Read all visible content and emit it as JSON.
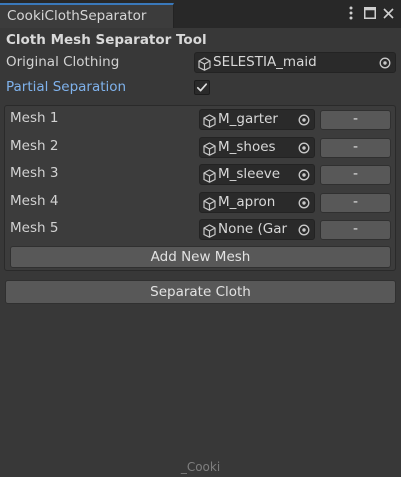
{
  "tab": {
    "title": "CookiClothSeparator"
  },
  "tool": {
    "title": "Cloth Mesh Separator Tool"
  },
  "original_clothing": {
    "label": "Original Clothing",
    "value": "SELESTIA_maid"
  },
  "partial_separation": {
    "label": "Partial Separation",
    "checked": true
  },
  "meshes": [
    {
      "label": "Mesh 1",
      "value": "M_garter",
      "button": "-"
    },
    {
      "label": "Mesh 2",
      "value": "M_shoes",
      "button": "-"
    },
    {
      "label": "Mesh 3",
      "value": "M_sleeve",
      "button": "-"
    },
    {
      "label": "Mesh 4",
      "value": "M_apron",
      "button": "-"
    },
    {
      "label": "Mesh 5",
      "value": "None (Gar",
      "button": "-"
    }
  ],
  "buttons": {
    "add_mesh": "Add New Mesh",
    "separate": "Separate Cloth"
  },
  "footer": {
    "text": "_Cooki"
  },
  "colors": {
    "accent": "#3a79bb",
    "link_label": "#7fb2ec",
    "background": "#383838"
  }
}
